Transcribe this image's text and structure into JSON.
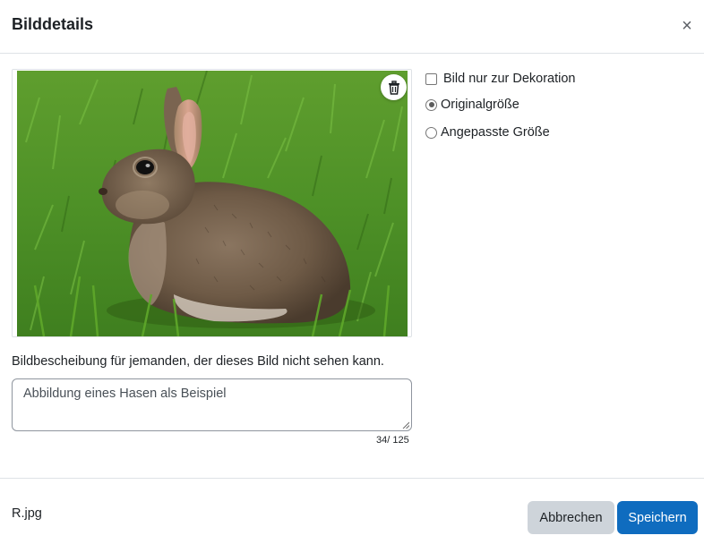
{
  "dialog": {
    "title": "Bilddetails",
    "close_icon": "close-icon"
  },
  "image": {
    "description": "",
    "delete_icon": "trash-icon"
  },
  "options": {
    "decorative_label": "Bild nur zur Dekoration",
    "decorative_checked": false,
    "original_size_label": "Originalgröße",
    "original_size_checked": true,
    "custom_size_label": "Angepasste Größe",
    "custom_size_checked": false
  },
  "alt_text": {
    "label": "Bildbescheibung für jemanden, der dieses Bild nicht sehen kann.",
    "value": "Abbildung eines Hasen als Beispiel",
    "counter": "34/ 125"
  },
  "footer": {
    "filename": "R.jpg",
    "cancel_label": "Abbrechen",
    "save_label": "Speichern"
  },
  "colors": {
    "primary": "#0f6cbf",
    "secondary": "#ced4da",
    "border": "#dee2e6"
  }
}
